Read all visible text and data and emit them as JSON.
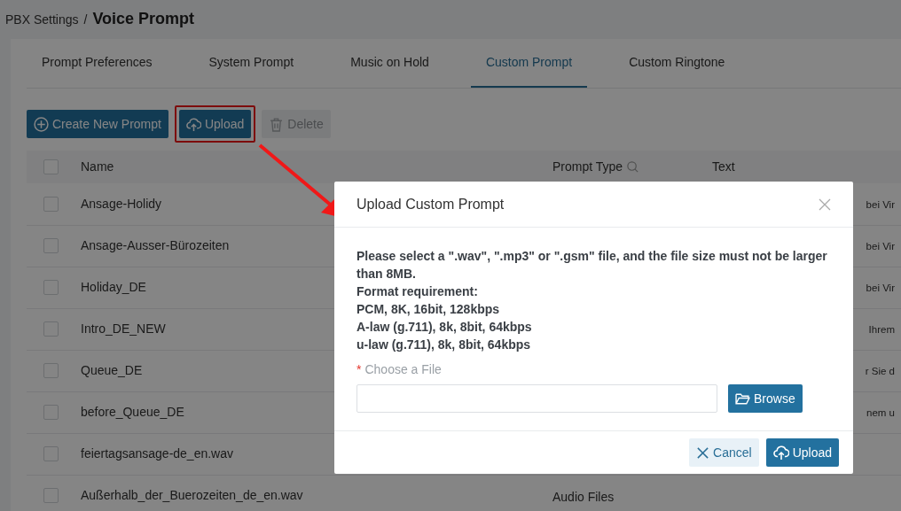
{
  "breadcrumb": {
    "parent": "PBX Settings",
    "separator": "/",
    "current": "Voice Prompt"
  },
  "tabs": [
    {
      "label": "Prompt Preferences",
      "selected": false
    },
    {
      "label": "System Prompt",
      "selected": false
    },
    {
      "label": "Music on Hold",
      "selected": false
    },
    {
      "label": "Custom Prompt",
      "selected": true
    },
    {
      "label": "Custom Ringtone",
      "selected": false
    }
  ],
  "toolbar": [
    {
      "label": "Create New Prompt",
      "kind": "create",
      "disabled": false,
      "highlighted": false
    },
    {
      "label": "Upload",
      "kind": "upload",
      "disabled": false,
      "highlighted": true
    },
    {
      "label": "Delete",
      "kind": "delete",
      "disabled": true,
      "highlighted": false
    }
  ],
  "table": {
    "header_checked": false,
    "columns": [
      {
        "label": "Name",
        "searchable": false
      },
      {
        "label": "Prompt Type",
        "searchable": true
      },
      {
        "label": "Text",
        "searchable": false
      }
    ],
    "rows": [
      {
        "checked": false,
        "name": "Ansage-Holidy",
        "text": "bei Vir"
      },
      {
        "checked": false,
        "name": "Ansage-Ausser-Bürozeiten",
        "text": "bei Vir"
      },
      {
        "checked": false,
        "name": "Holiday_DE",
        "text": "bei Vir"
      },
      {
        "checked": false,
        "name": "Intro_DE_NEW",
        "text": "Ihrem"
      },
      {
        "checked": false,
        "name": "Queue_DE",
        "text": "r Sie d"
      },
      {
        "checked": false,
        "name": "before_Queue_DE",
        "text": "nem u"
      },
      {
        "checked": false,
        "name": "feiertagsansage-de_en.wav"
      },
      {
        "checked": false,
        "name": "Außerhalb_der_Buerozeiten_de_en.wav",
        "prompt_type": "Audio Files"
      }
    ]
  },
  "modal": {
    "title": "Upload Custom Prompt",
    "instructions": [
      "Please select a \".wav\", \".mp3\" or \".gsm\" file, and the file size must not be larger than 8MB.",
      "Format requirement:",
      "PCM, 8K, 16bit, 128kbps",
      "A-law (g.711), 8k, 8bit, 64kbps",
      "u-law (g.711), 8k, 8bit, 64kbps"
    ],
    "field_label": "Choose a File",
    "required_marker": "*",
    "browse_label": "Browse",
    "buttons": [
      {
        "label": "Cancel",
        "kind": "cancel"
      },
      {
        "label": "Upload",
        "kind": "upload"
      }
    ]
  }
}
